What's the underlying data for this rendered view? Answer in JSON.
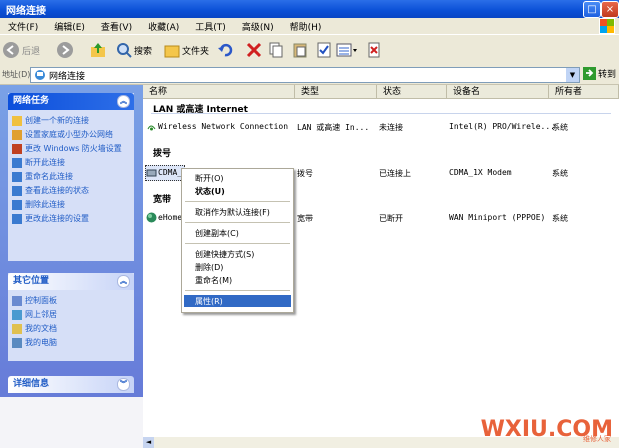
{
  "window": {
    "title": "网络连接"
  },
  "menu": [
    "文件(F)",
    "编辑(E)",
    "查看(V)",
    "收藏(A)",
    "工具(T)",
    "高级(N)",
    "帮助(H)"
  ],
  "toolbar": {
    "back": "后退",
    "search": "搜索",
    "folders": "文件夹"
  },
  "address": {
    "label": "地址(D)",
    "value": "网络连接",
    "go": "转到"
  },
  "tasks": {
    "network_title": "网络任务",
    "network_items": [
      "创建一个新的连接",
      "设置家庭或小型办公网络",
      "更改 Windows 防火墙设置",
      "断开此连接",
      "重命名此连接",
      "查看此连接的状态",
      "删除此连接",
      "更改此连接的设置"
    ],
    "other_title": "其它位置",
    "other_items": [
      "控制面板",
      "网上邻居",
      "我的文档",
      "我的电脑"
    ],
    "details_title": "详细信息"
  },
  "columns": [
    "名称",
    "类型",
    "状态",
    "设备名",
    "所有者"
  ],
  "groups": {
    "lan": "LAN 或高速 Internet",
    "dialup": "拨号",
    "broadband": "宽带"
  },
  "rows": [
    {
      "name": "Wireless Network Connection",
      "type": "LAN 或高速 In...",
      "status": "未连接",
      "device": "Intel(R) PRO/Wirele...",
      "owner": "系统"
    },
    {
      "name": "CDMA_",
      "type": "拨号",
      "status": "已连接上",
      "device": "CDMA_1X Modem",
      "owner": "系统"
    },
    {
      "name": "eHome",
      "type": "宽带",
      "status": "已断开",
      "device": "WAN Miniport (PPPOE)",
      "owner": "系统"
    }
  ],
  "context_menu": [
    "断开(O)",
    "状态(U)",
    "取消作为默认连接(F)",
    "创建副本(C)",
    "创建快捷方式(S)",
    "删除(D)",
    "重命名(M)",
    "属性(R)"
  ],
  "watermark": {
    "brand": "WXIU.COM",
    "sub": "维修人家"
  }
}
